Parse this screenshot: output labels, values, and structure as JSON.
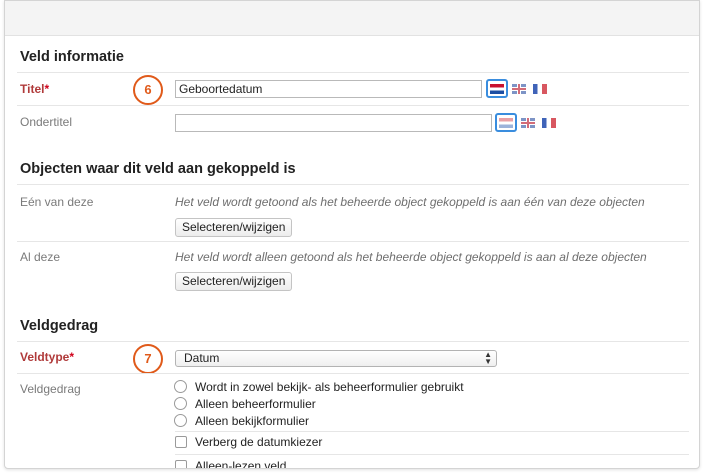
{
  "sections": {
    "veld_informatie": "Veld informatie",
    "objecten": "Objecten waar dit veld aan gekoppeld is",
    "veldgedrag": "Veldgedrag"
  },
  "fields": {
    "titel": {
      "label": "Titel",
      "required_mark": "*",
      "value": "Geboortedatum"
    },
    "ondertitel": {
      "label": "Ondertitel",
      "value": ""
    },
    "een_van_deze": {
      "label": "Eén van deze",
      "description": "Het veld wordt getoond als het beheerde object gekoppeld is aan één van deze objecten",
      "button": "Selecteren/wijzigen"
    },
    "al_deze": {
      "label": "Al deze",
      "description": "Het veld wordt alleen getoond als het beheerde object gekoppeld is aan al deze objecten",
      "button": "Selecteren/wijzigen"
    },
    "veldtype": {
      "label": "Veldtype",
      "required_mark": "*",
      "selected": "Datum"
    },
    "veldgedrag": {
      "label": "Veldgedrag",
      "radio_options": [
        "Wordt in zowel bekijk- als beheerformulier gebruikt",
        "Alleen beheerformulier",
        "Alleen bekijkformulier"
      ],
      "checkboxes": [
        "Verberg de datumkiezer",
        "Alleen-lezen veld"
      ]
    }
  },
  "callouts": {
    "step6": "6",
    "step7": "7"
  },
  "flags": [
    "nl-flag-icon",
    "gb-flag-icon",
    "fr-flag-icon"
  ],
  "colors": {
    "required": "#d0021b",
    "callout": "#e05a1a",
    "active_flag_border": "#3a8dde"
  }
}
